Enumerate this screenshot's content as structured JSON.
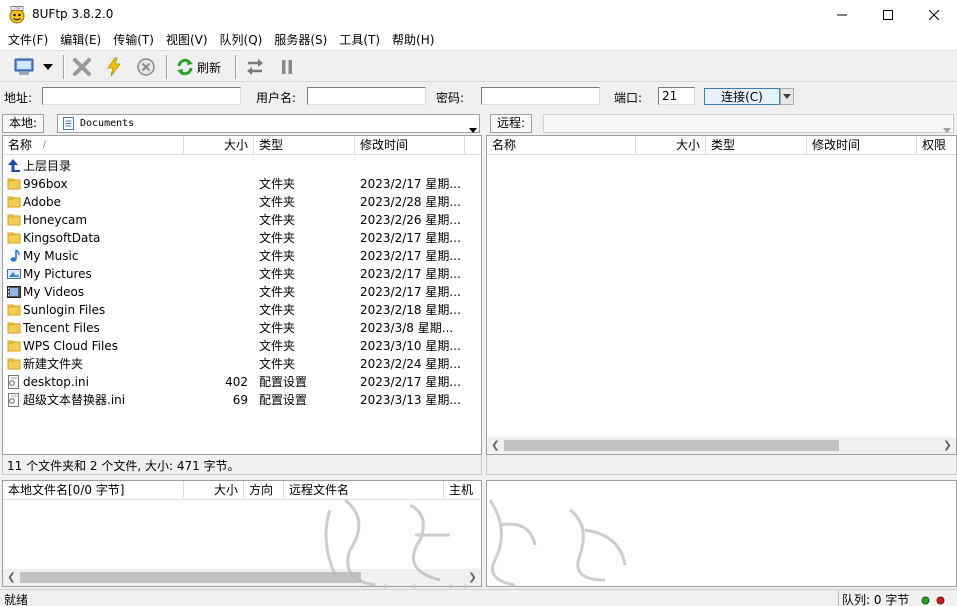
{
  "window": {
    "title": "8UFtp 3.8.2.0",
    "controls": [
      "—",
      "☐",
      "✕"
    ]
  },
  "menu": [
    "文件(F)",
    "编辑(E)",
    "传输(T)",
    "视图(V)",
    "队列(Q)",
    "服务器(S)",
    "工具(T)",
    "帮助(H)"
  ],
  "toolbar": {
    "refresh_label": "刷新"
  },
  "address_bar": {
    "address_label": "地址:",
    "address_value": "",
    "username_label": "用户名:",
    "username_value": "",
    "password_label": "密码:",
    "password_value": "",
    "port_label": "端口:",
    "port_value": "21",
    "connect_label": "连接(C)"
  },
  "local": {
    "label": "本地:",
    "path": "Documents",
    "columns": [
      "名称",
      "大小",
      "类型",
      "修改时间"
    ],
    "sort_indicator": "/",
    "parent_label": "上层目录",
    "files": [
      {
        "name": "996box",
        "size": "",
        "type": "文件夹",
        "modified": "2023/2/17 星期...",
        "icon": "folder"
      },
      {
        "name": "Adobe",
        "size": "",
        "type": "文件夹",
        "modified": "2023/2/28 星期...",
        "icon": "folder"
      },
      {
        "name": "Honeycam",
        "size": "",
        "type": "文件夹",
        "modified": "2023/2/26 星期...",
        "icon": "folder"
      },
      {
        "name": "KingsoftData",
        "size": "",
        "type": "文件夹",
        "modified": "2023/2/17 星期...",
        "icon": "folder"
      },
      {
        "name": "My Music",
        "size": "",
        "type": "文件夹",
        "modified": "2023/2/17 星期...",
        "icon": "music"
      },
      {
        "name": "My Pictures",
        "size": "",
        "type": "文件夹",
        "modified": "2023/2/17 星期...",
        "icon": "pictures"
      },
      {
        "name": "My Videos",
        "size": "",
        "type": "文件夹",
        "modified": "2023/2/17 星期...",
        "icon": "videos"
      },
      {
        "name": "Sunlogin Files",
        "size": "",
        "type": "文件夹",
        "modified": "2023/2/18 星期...",
        "icon": "folder"
      },
      {
        "name": "Tencent Files",
        "size": "",
        "type": "文件夹",
        "modified": "2023/3/8 星期...",
        "icon": "folder"
      },
      {
        "name": "WPS Cloud Files",
        "size": "",
        "type": "文件夹",
        "modified": "2023/3/10 星期...",
        "icon": "folder"
      },
      {
        "name": "新建文件夹",
        "size": "",
        "type": "文件夹",
        "modified": "2023/2/24 星期...",
        "icon": "folder"
      },
      {
        "name": "desktop.ini",
        "size": "402",
        "type": "配置设置",
        "modified": "2023/2/17 星期...",
        "icon": "ini"
      },
      {
        "name": "超级文本替换器.ini",
        "size": "69",
        "type": "配置设置",
        "modified": "2023/3/13 星期...",
        "icon": "ini"
      }
    ],
    "summary": "11 个文件夹和 2 个文件, 大小: 471 字节。"
  },
  "remote": {
    "label": "远程:",
    "path": "",
    "columns": [
      "名称",
      "大小",
      "类型",
      "修改时间",
      "权限"
    ]
  },
  "queue": {
    "columns": [
      "本地文件名[0/0 字节]",
      "大小",
      "方向",
      "远程文件名",
      "主机"
    ]
  },
  "status": {
    "left": "就绪",
    "queue_label": "队列: 0 字节"
  },
  "watermark_text": "www.bulaobbs.com"
}
